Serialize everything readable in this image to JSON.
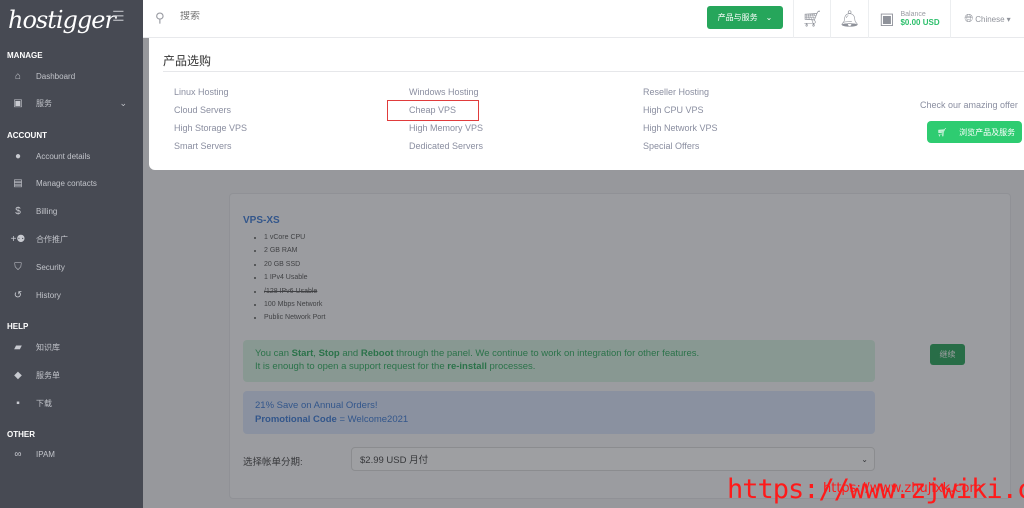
{
  "sidebar": {
    "logo": "hostigger",
    "sections": [
      {
        "title": "MANAGE",
        "items": [
          {
            "label": "Dashboard",
            "icon": "home-icon"
          },
          {
            "label": "服务",
            "icon": "id-card-icon",
            "expandable": true
          }
        ]
      },
      {
        "title": "ACCOUNT",
        "items": [
          {
            "label": "Account details",
            "icon": "user-icon"
          },
          {
            "label": "Manage contacts",
            "icon": "contacts-icon"
          },
          {
            "label": "Billing",
            "icon": "dollar-icon"
          },
          {
            "label": "合作推广",
            "icon": "users-plus-icon"
          },
          {
            "label": "Security",
            "icon": "shield-icon"
          },
          {
            "label": "History",
            "icon": "history-icon"
          }
        ]
      },
      {
        "title": "HELP",
        "items": [
          {
            "label": "知识库",
            "icon": "document-icon"
          },
          {
            "label": "服务单",
            "icon": "tickets-icon"
          },
          {
            "label": "下载",
            "icon": "save-icon"
          }
        ]
      },
      {
        "title": "OTHER",
        "items": [
          {
            "label": "IPAM",
            "icon": "link-icon"
          }
        ]
      }
    ]
  },
  "topbar": {
    "search_placeholder": "搜索",
    "products_button": "产品与服务",
    "balance_label": "Balance",
    "balance_value": "$0.00 USD",
    "language": "Chinese"
  },
  "dropdown": {
    "title": "产品选购",
    "columns": [
      [
        "Linux Hosting",
        "Cloud Servers",
        "High Storage VPS",
        "Smart Servers"
      ],
      [
        "Windows Hosting",
        "Cheap VPS",
        "High Memory VPS",
        "Dedicated Servers"
      ],
      [
        "Reseller Hosting",
        "High CPU VPS",
        "High Network VPS",
        "Special Offers"
      ]
    ],
    "highlighted": "Cheap VPS",
    "offer_text": "Check our amazing offer",
    "browse_button": "浏览产品及服务"
  },
  "product": {
    "name": "VPS-XS",
    "features": [
      "1 vCore CPU",
      "2 GB RAM",
      "20 GB SSD",
      "1 IPv4 Usable",
      "/128 IPv6 Usable",
      "100 Mbps Network",
      "Public Network Port"
    ],
    "notice": {
      "p1": "You can ",
      "b1": "Start",
      "p2": ", ",
      "b2": "Stop",
      "p3": " and ",
      "b3": "Reboot",
      "p4": " through the panel. We continue to work on integration for other features.",
      "p5": "It is enough to open a support request for the ",
      "b4": "re-install",
      "p6": " processes."
    },
    "promo": {
      "line1": "21% Save on Annual Orders!",
      "code_label": "Promotional Code",
      "code_sep": " = ",
      "code": "Welcome2021"
    },
    "billing_label": "选择帐单分期:",
    "billing_value": "$2.99 USD 月付",
    "continue_button": "继续"
  },
  "watermarks": [
    "https://www.zjwiki.com",
    "https://www.zhujixk.com"
  ],
  "colors": {
    "accent_green": "#26a65b",
    "link_blue": "#3c7bd6",
    "sidebar": "#474a53",
    "highlight_box": "#e03c3c"
  }
}
